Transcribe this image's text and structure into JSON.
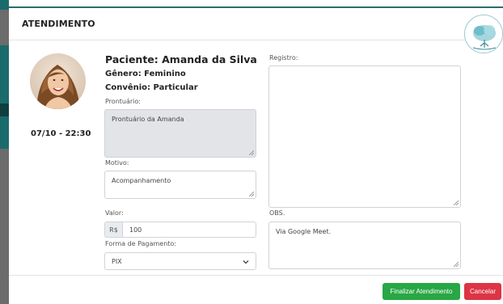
{
  "modal": {
    "title": "ATENDIMENTO"
  },
  "patient": {
    "datetime": "07/10 - 22:30",
    "name": "Paciente: Amanda da Silva",
    "gender": "Gênero: Feminino",
    "plan": "Convênio: Particular"
  },
  "prontuario": {
    "label": "Prontuário:",
    "value": "Prontuário da Amanda"
  },
  "motivo": {
    "label": "Motivo:",
    "value": "Acompanhamento"
  },
  "valor": {
    "label": "Valor:",
    "currency": "R$",
    "value": "100"
  },
  "pagamento": {
    "label": "Forma de Pagamento:",
    "selected": "PIX"
  },
  "registro": {
    "label": "Registro:",
    "value": ""
  },
  "obs": {
    "label": "OBS.",
    "value": "Via Google Meet."
  },
  "buttons": {
    "finish": "Finalizar Atendimento",
    "cancel": "Cancelar"
  },
  "colors": {
    "finish": "#28a745",
    "cancel": "#dc3545",
    "accent": "#2e6b70"
  }
}
